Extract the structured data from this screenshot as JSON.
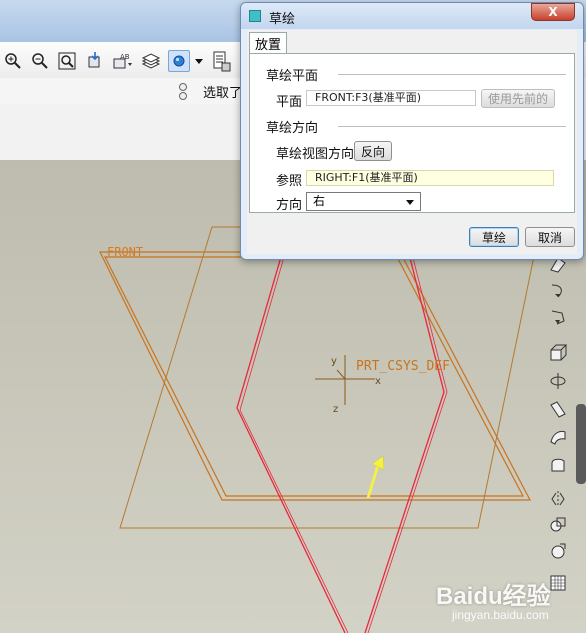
{
  "toolbar": {
    "icons": [
      "zoom-in-icon",
      "zoom-out-icon",
      "zoom-fit-icon",
      "orient-icon",
      "saved-views-icon",
      "layers-icon",
      "display-style-icon",
      "dropdown-icon",
      "model-tree-icon"
    ],
    "filter_label": "选取了"
  },
  "model": {
    "datum_front": "FRONT",
    "csys_label": "PRT_CSYS_DEF",
    "axis_x": "x",
    "axis_y": "y",
    "axis_z": "z"
  },
  "dialog": {
    "title": "草绘",
    "close_label": "X",
    "tab_placement": "放置",
    "section_sketch_plane": "草绘平面",
    "plane_label": "平面",
    "plane_value": "FRONT:F3(基准平面)",
    "use_previous_label": "使用先前的",
    "section_orientation": "草绘方向",
    "view_direction_label": "草绘视图方向",
    "flip_label": "反向",
    "reference_label": "参照",
    "reference_value": "RIGHT:F1(基准平面)",
    "direction_label": "方向",
    "direction_value": "右",
    "ok_label": "草绘",
    "cancel_label": "取消"
  },
  "watermark": {
    "brand": "Baidu经验",
    "url": "jingyan.baidu.com"
  },
  "colors": {
    "datum": "#c8741f",
    "selected": "#e8283c",
    "arrow": "#f3f04a",
    "accent": "#3c7fb1"
  }
}
